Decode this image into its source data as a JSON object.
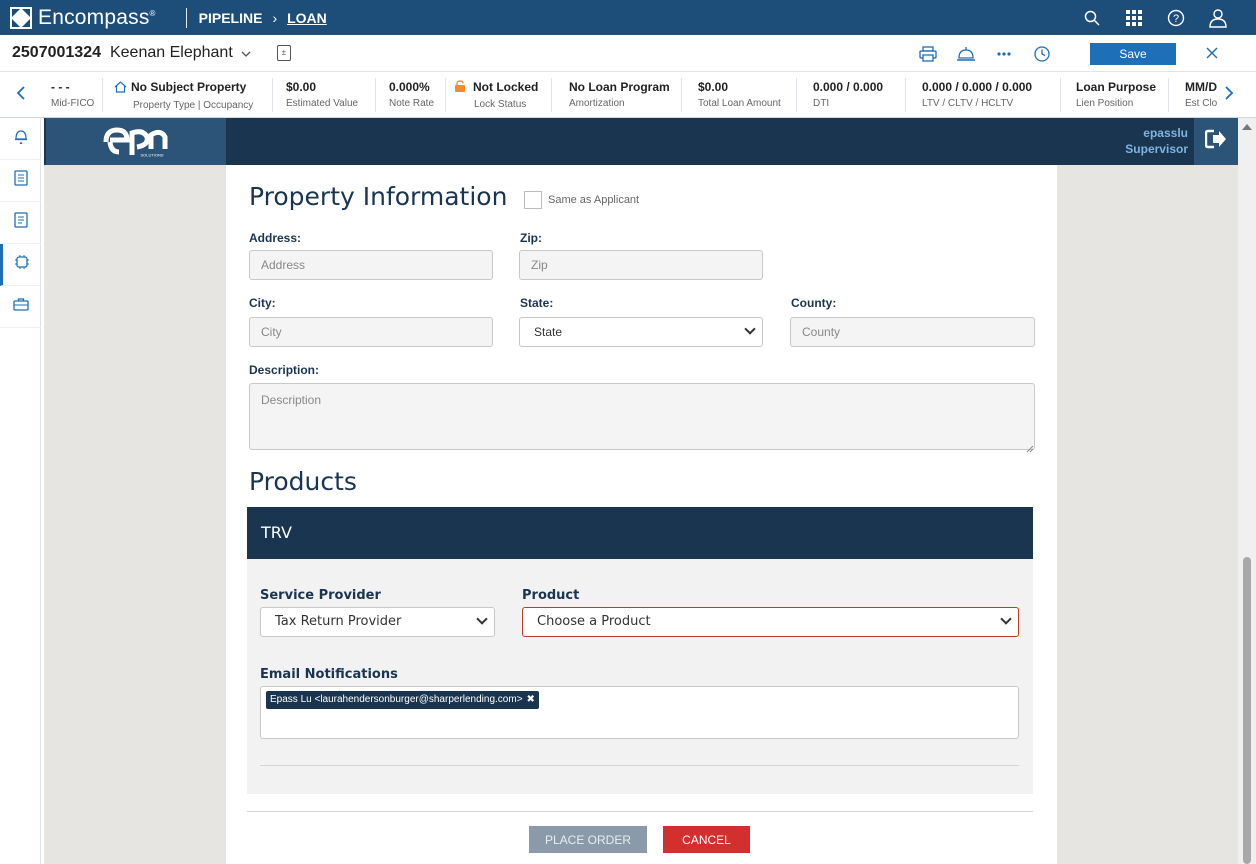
{
  "app": {
    "brand": "Encompass",
    "brand_mark": "®",
    "nav": {
      "pipeline": "PIPELINE",
      "separator": "›",
      "loan": "LOAN"
    }
  },
  "loan": {
    "number": "2507001324",
    "borrower": "Keenan Elephant",
    "save_label": "Save"
  },
  "summary": [
    {
      "value": "- - -",
      "label": "Mid-FICO"
    },
    {
      "value": "No Subject Property",
      "label": "Property Type | Occupancy"
    },
    {
      "value": "$0.00",
      "label": "Estimated Value"
    },
    {
      "value": "0.000%",
      "label": "Note Rate"
    },
    {
      "value": "Not Locked",
      "label": "Lock Status"
    },
    {
      "value": "No Loan Program",
      "label": "Amortization"
    },
    {
      "value": "$0.00",
      "label": "Total Loan Amount"
    },
    {
      "value": "0.000 / 0.000",
      "label": "DTI"
    },
    {
      "value": "0.000 / 0.000 / 0.000",
      "label": "LTV / CLTV / HCLTV"
    },
    {
      "value": "Loan Purpose",
      "label": "Lien Position"
    },
    {
      "value": "MM/D",
      "label": "Est Clo"
    }
  ],
  "epn": {
    "user": "epasslu",
    "role": "Supervisor"
  },
  "property": {
    "title": "Property Information",
    "same_as_applicant": "Same as Applicant",
    "address_label": "Address:",
    "address_placeholder": "Address",
    "zip_label": "Zip:",
    "zip_placeholder": "Zip",
    "city_label": "City:",
    "city_placeholder": "City",
    "state_label": "State:",
    "state_value": "State",
    "county_label": "County:",
    "county_placeholder": "County",
    "description_label": "Description:",
    "description_placeholder": "Description"
  },
  "products": {
    "title": "Products",
    "trv": {
      "header": "TRV",
      "service_provider_label": "Service Provider",
      "service_provider_value": "Tax Return Provider",
      "product_label": "Product",
      "product_value": "Choose a Product",
      "email_label": "Email Notifications",
      "email_chip": "Epass Lu <laurahendersonburger@sharperlending.com>",
      "chip_remove": "✖"
    }
  },
  "actions": {
    "place_order": "PLACE ORDER",
    "cancel": "CANCEL"
  }
}
